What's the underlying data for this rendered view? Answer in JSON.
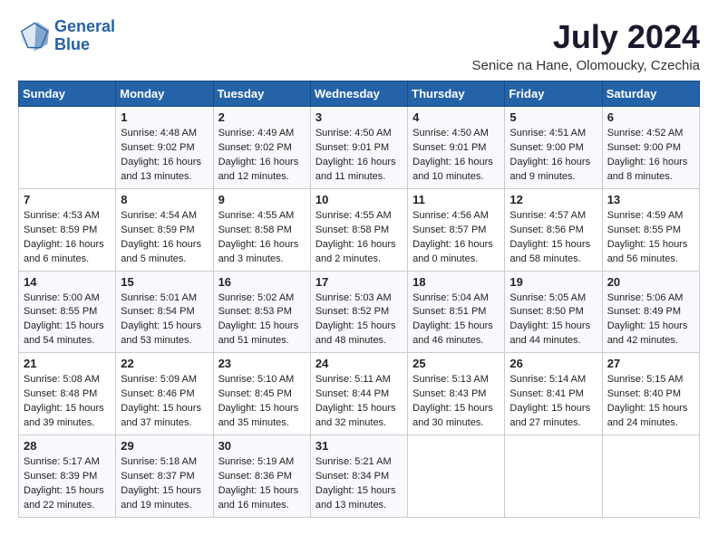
{
  "logo": {
    "line1": "General",
    "line2": "Blue"
  },
  "title": "July 2024",
  "location": "Senice na Hane, Olomoucky, Czechia",
  "days_header": [
    "Sunday",
    "Monday",
    "Tuesday",
    "Wednesday",
    "Thursday",
    "Friday",
    "Saturday"
  ],
  "weeks": [
    [
      {
        "day": "",
        "info": ""
      },
      {
        "day": "1",
        "info": "Sunrise: 4:48 AM\nSunset: 9:02 PM\nDaylight: 16 hours\nand 13 minutes."
      },
      {
        "day": "2",
        "info": "Sunrise: 4:49 AM\nSunset: 9:02 PM\nDaylight: 16 hours\nand 12 minutes."
      },
      {
        "day": "3",
        "info": "Sunrise: 4:50 AM\nSunset: 9:01 PM\nDaylight: 16 hours\nand 11 minutes."
      },
      {
        "day": "4",
        "info": "Sunrise: 4:50 AM\nSunset: 9:01 PM\nDaylight: 16 hours\nand 10 minutes."
      },
      {
        "day": "5",
        "info": "Sunrise: 4:51 AM\nSunset: 9:00 PM\nDaylight: 16 hours\nand 9 minutes."
      },
      {
        "day": "6",
        "info": "Sunrise: 4:52 AM\nSunset: 9:00 PM\nDaylight: 16 hours\nand 8 minutes."
      }
    ],
    [
      {
        "day": "7",
        "info": "Sunrise: 4:53 AM\nSunset: 8:59 PM\nDaylight: 16 hours\nand 6 minutes."
      },
      {
        "day": "8",
        "info": "Sunrise: 4:54 AM\nSunset: 8:59 PM\nDaylight: 16 hours\nand 5 minutes."
      },
      {
        "day": "9",
        "info": "Sunrise: 4:55 AM\nSunset: 8:58 PM\nDaylight: 16 hours\nand 3 minutes."
      },
      {
        "day": "10",
        "info": "Sunrise: 4:55 AM\nSunset: 8:58 PM\nDaylight: 16 hours\nand 2 minutes."
      },
      {
        "day": "11",
        "info": "Sunrise: 4:56 AM\nSunset: 8:57 PM\nDaylight: 16 hours\nand 0 minutes."
      },
      {
        "day": "12",
        "info": "Sunrise: 4:57 AM\nSunset: 8:56 PM\nDaylight: 15 hours\nand 58 minutes."
      },
      {
        "day": "13",
        "info": "Sunrise: 4:59 AM\nSunset: 8:55 PM\nDaylight: 15 hours\nand 56 minutes."
      }
    ],
    [
      {
        "day": "14",
        "info": "Sunrise: 5:00 AM\nSunset: 8:55 PM\nDaylight: 15 hours\nand 54 minutes."
      },
      {
        "day": "15",
        "info": "Sunrise: 5:01 AM\nSunset: 8:54 PM\nDaylight: 15 hours\nand 53 minutes."
      },
      {
        "day": "16",
        "info": "Sunrise: 5:02 AM\nSunset: 8:53 PM\nDaylight: 15 hours\nand 51 minutes."
      },
      {
        "day": "17",
        "info": "Sunrise: 5:03 AM\nSunset: 8:52 PM\nDaylight: 15 hours\nand 48 minutes."
      },
      {
        "day": "18",
        "info": "Sunrise: 5:04 AM\nSunset: 8:51 PM\nDaylight: 15 hours\nand 46 minutes."
      },
      {
        "day": "19",
        "info": "Sunrise: 5:05 AM\nSunset: 8:50 PM\nDaylight: 15 hours\nand 44 minutes."
      },
      {
        "day": "20",
        "info": "Sunrise: 5:06 AM\nSunset: 8:49 PM\nDaylight: 15 hours\nand 42 minutes."
      }
    ],
    [
      {
        "day": "21",
        "info": "Sunrise: 5:08 AM\nSunset: 8:48 PM\nDaylight: 15 hours\nand 39 minutes."
      },
      {
        "day": "22",
        "info": "Sunrise: 5:09 AM\nSunset: 8:46 PM\nDaylight: 15 hours\nand 37 minutes."
      },
      {
        "day": "23",
        "info": "Sunrise: 5:10 AM\nSunset: 8:45 PM\nDaylight: 15 hours\nand 35 minutes."
      },
      {
        "day": "24",
        "info": "Sunrise: 5:11 AM\nSunset: 8:44 PM\nDaylight: 15 hours\nand 32 minutes."
      },
      {
        "day": "25",
        "info": "Sunrise: 5:13 AM\nSunset: 8:43 PM\nDaylight: 15 hours\nand 30 minutes."
      },
      {
        "day": "26",
        "info": "Sunrise: 5:14 AM\nSunset: 8:41 PM\nDaylight: 15 hours\nand 27 minutes."
      },
      {
        "day": "27",
        "info": "Sunrise: 5:15 AM\nSunset: 8:40 PM\nDaylight: 15 hours\nand 24 minutes."
      }
    ],
    [
      {
        "day": "28",
        "info": "Sunrise: 5:17 AM\nSunset: 8:39 PM\nDaylight: 15 hours\nand 22 minutes."
      },
      {
        "day": "29",
        "info": "Sunrise: 5:18 AM\nSunset: 8:37 PM\nDaylight: 15 hours\nand 19 minutes."
      },
      {
        "day": "30",
        "info": "Sunrise: 5:19 AM\nSunset: 8:36 PM\nDaylight: 15 hours\nand 16 minutes."
      },
      {
        "day": "31",
        "info": "Sunrise: 5:21 AM\nSunset: 8:34 PM\nDaylight: 15 hours\nand 13 minutes."
      },
      {
        "day": "",
        "info": ""
      },
      {
        "day": "",
        "info": ""
      },
      {
        "day": "",
        "info": ""
      }
    ]
  ]
}
